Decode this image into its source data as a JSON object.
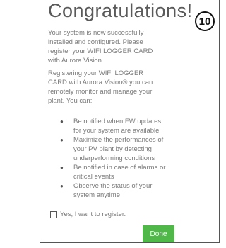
{
  "dialog": {
    "title": "Congratulations!",
    "step_number": "10",
    "intro_lines": [
      "Your system is now successfully",
      "installed and configured. Please",
      "register your WIFI LOGGER CARD",
      "with Aurora Vision"
    ],
    "registering_lines": [
      "Registering your WIFI LOGGER",
      "CARD with Aurora Vision® you can",
      "remotely monitor and manage your",
      "plant. You can:"
    ],
    "benefits": [
      [
        "Be notified when FW updates",
        "for your system are available"
      ],
      [
        "Maximize the performances of",
        "your PV plant by detecting",
        "underperforming conditions"
      ],
      [
        "Be notified in case of alarms or",
        "critical events"
      ],
      [
        "Observe the status of your",
        "system anytime"
      ]
    ],
    "register_checkbox": {
      "label": "Yes, I want to register.",
      "checked": false
    },
    "done_label": "Done",
    "done_color": "#4fb849"
  }
}
